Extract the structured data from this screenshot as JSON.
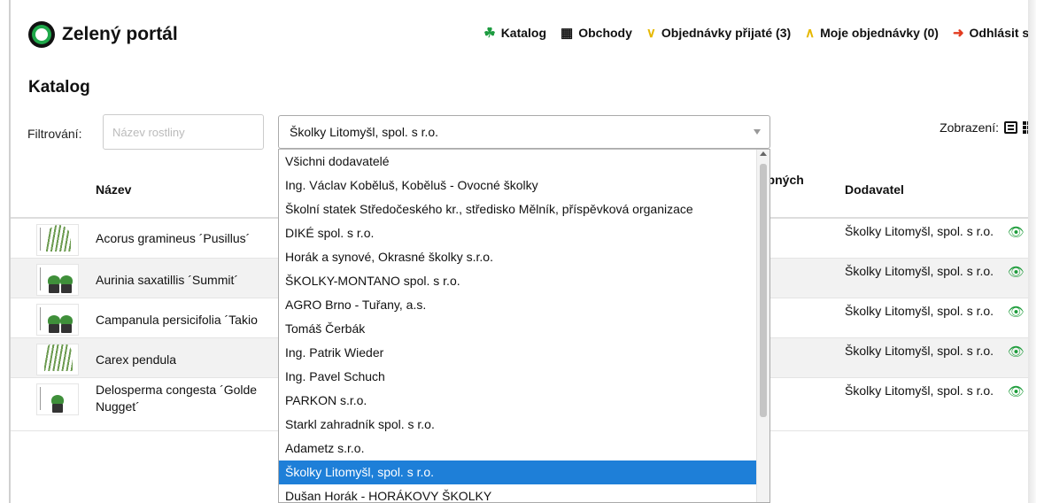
{
  "app": {
    "title": "Zelený portál"
  },
  "nav": {
    "catalog": "Katalog",
    "shops": "Obchody",
    "orders_received": "Objednávky přijaté (3)",
    "my_orders": "Moje objednávky (0)",
    "logout": "Odhlásit se"
  },
  "page": {
    "title": "Katalog"
  },
  "filter": {
    "label": "Filtrování:",
    "name_placeholder": "Název rostliny",
    "selected_supplier": "Školky Litomyšl, spol. s r.o."
  },
  "view": {
    "label": "Zobrazení:"
  },
  "table": {
    "headers": {
      "name": "Název",
      "available_partial": "upných",
      "supplier": "Dodavatel"
    },
    "rows": [
      {
        "name": "Acorus gramineus ´Pusillus´",
        "supplier": "Školky Litomyšl, spol. s r.o."
      },
      {
        "name": "Aurinia saxatillis ´Summit´",
        "supplier": "Školky Litomyšl, spol. s r.o."
      },
      {
        "name": "Campanula persicifolia ´Takio",
        "supplier": "Školky Litomyšl, spol. s r.o."
      },
      {
        "name": "Carex pendula",
        "supplier": "Školky Litomyšl, spol. s r.o."
      },
      {
        "name": "Delosperma congesta ´Golde Nugget´",
        "supplier": "Školky Litomyšl, spol. s r.o."
      }
    ]
  },
  "dropdown": {
    "options": [
      "Všichni dodavatelé",
      "Ing. Václav Koběluš, Koběluš - Ovocné školky",
      "Školní statek Středočeského kr., středisko Mělník, příspěvková organizace",
      "DIKÉ spol. s r.o.",
      "Horák a synové, Okrasné školky s.r.o.",
      "ŠKOLKY-MONTANO spol. s r.o.",
      "AGRO Brno - Tuřany, a.s.",
      "Tomáš Čerbák",
      "Ing. Patrik Wieder",
      "Ing. Pavel Schuch",
      "PARKON s.r.o.",
      "Starkl zahradník spol. s r.o.",
      "Adametz s.r.o.",
      "Školky Litomyšl, spol. s r.o.",
      "Dušan Horák - HORÁKOVY ŠKOLKY"
    ],
    "selected_index": 13
  },
  "colors": {
    "accent_green": "#1c9b3f",
    "selection_blue": "#1e7fd8"
  },
  "icons": {
    "logo": "circle-logo-icon",
    "catalog": "plant-icon",
    "shops": "shop-icon",
    "orders_received": "double-chevron-down-icon",
    "my_orders": "double-chevron-up-icon",
    "logout": "logout-icon",
    "view_list": "list-view-icon",
    "view_grid": "grid-view-icon",
    "row_action": "eye-icon"
  }
}
